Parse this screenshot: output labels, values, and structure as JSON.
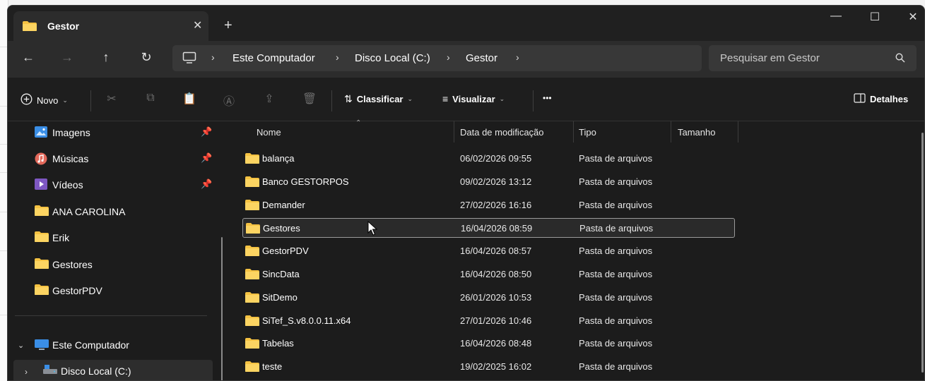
{
  "window": {
    "tab_title": "Gestor",
    "close_tab": "✕",
    "new_tab": "+",
    "minimize": "—",
    "maximize": "☐",
    "close": "✕"
  },
  "address": {
    "back": "←",
    "forward": "→",
    "up": "↑",
    "refresh": "↻",
    "crumbs": [
      "Este Computador",
      "Disco Local (C:)",
      "Gestor"
    ],
    "separator": "›",
    "search_placeholder": "Pesquisar em Gestor"
  },
  "toolbar": {
    "new_label": "Novo",
    "sort_label": "Classificar",
    "view_label": "Visualizar",
    "more_label": "•••",
    "details_label": "Detalhes"
  },
  "sidebar": {
    "pinned": [
      {
        "label": "Imagens",
        "icon": "images-icon",
        "pin": "📌"
      },
      {
        "label": "Músicas",
        "icon": "music-icon",
        "pin": "📌"
      },
      {
        "label": "Vídeos",
        "icon": "videos-icon",
        "pin": "📌"
      }
    ],
    "folders": [
      "ANA CAROLINA",
      "Erik",
      "Gestores",
      "GestorPDV"
    ],
    "this_pc": "Este Computador",
    "local_disk": "Disco Local (C:)"
  },
  "columns": {
    "name": "Nome",
    "modified": "Data de modificação",
    "type": "Tipo",
    "size": "Tamanho"
  },
  "files": [
    {
      "name": "balança",
      "modified": "06/02/2026 09:55",
      "type": "Pasta de arquivos",
      "size": ""
    },
    {
      "name": "Banco GESTORPOS",
      "modified": "09/02/2026 13:12",
      "type": "Pasta de arquivos",
      "size": ""
    },
    {
      "name": "Demander",
      "modified": "27/02/2026 16:16",
      "type": "Pasta de arquivos",
      "size": ""
    },
    {
      "name": "Gestores",
      "modified": "16/04/2026 08:59",
      "type": "Pasta de arquivos",
      "size": ""
    },
    {
      "name": "GestorPDV",
      "modified": "16/04/2026 08:57",
      "type": "Pasta de arquivos",
      "size": ""
    },
    {
      "name": "SincData",
      "modified": "16/04/2026 08:50",
      "type": "Pasta de arquivos",
      "size": ""
    },
    {
      "name": "SitDemo",
      "modified": "26/01/2026 10:53",
      "type": "Pasta de arquivos",
      "size": ""
    },
    {
      "name": "SiTef_S.v8.0.0.11.x64",
      "modified": "27/01/2026 10:46",
      "type": "Pasta de arquivos",
      "size": ""
    },
    {
      "name": "Tabelas",
      "modified": "16/04/2026 08:48",
      "type": "Pasta de arquivos",
      "size": ""
    },
    {
      "name": "teste",
      "modified": "19/02/2025 16:02",
      "type": "Pasta de arquivos",
      "size": ""
    }
  ],
  "colors": {
    "folder": "#f5c242",
    "background": "#1c1c1c",
    "selected_border": "#9a9a9a"
  }
}
